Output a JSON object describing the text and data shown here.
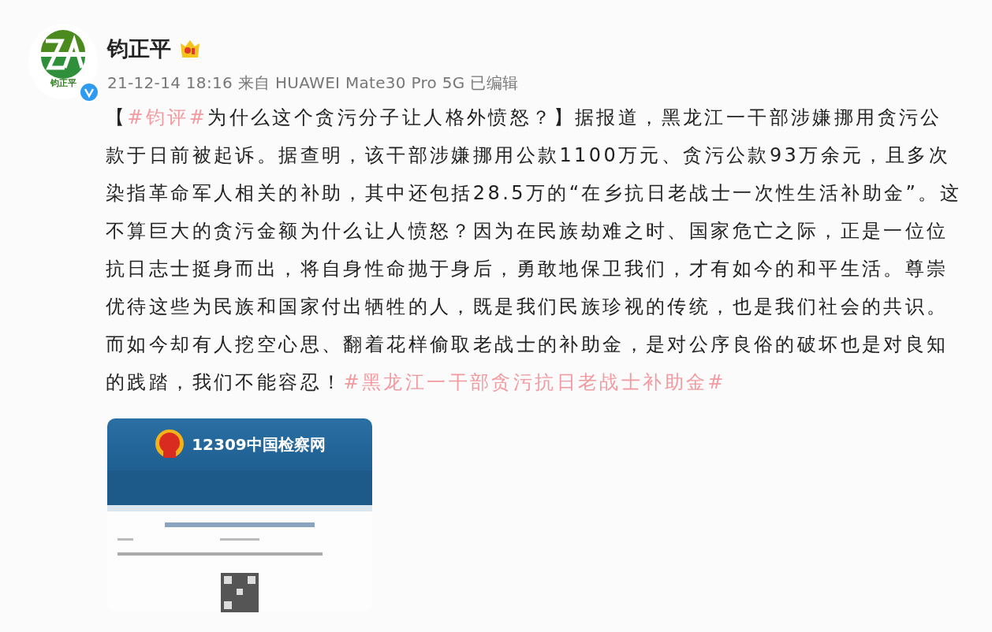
{
  "post": {
    "author": "钧正平",
    "avatar_caption": "钧正平",
    "meta": "21-12-14 18:16 来自 HUAWEI Mate30 Pro 5G 已编辑",
    "text": [
      {
        "kind": "text",
        "text": "【"
      },
      {
        "kind": "hashtag",
        "text": "#钧评#"
      },
      {
        "kind": "text",
        "text": "为什么这个贪污分子让人格外愤怒？】据报道，黑龙江一干部涉嫌挪用贪污公款于日前被起诉。据查明，该干部涉嫌挪用公款1100万元、贪污公款93万余元，且多次染指革命军人相关的补助，其中还包括28.5万的“在乡抗日老战士一次性生活补助金”。这不算巨大的贪污金额为什么让人愤怒？因为在民族劫难之时、国家危亡之际，正是一位位抗日志士挺身而出，将自身性命抛于身后，勇敢地保卫我们，才有如今的和平生活。尊崇优待这些为民族和国家付出牺牲的人，既是我们民族珍视的传统，也是我们社会的共识。而如今却有人挖空心思、翻着花样偷取老战士的补助金，是对公序良俗的破坏也是对良知的践踏，我们不能容忍！"
      },
      {
        "kind": "hashtag",
        "text": "#黑龙江一干部贪污抗日老战士补助金#"
      }
    ],
    "image": {
      "site_title": "12309中国检察网"
    }
  }
}
